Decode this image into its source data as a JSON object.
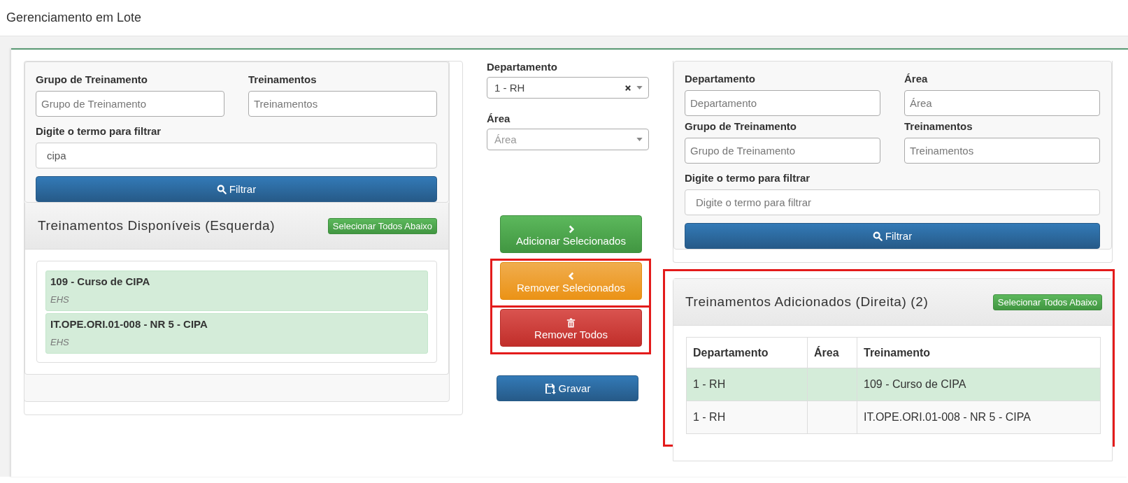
{
  "page_title": "Gerenciamento em Lote",
  "left": {
    "fields": [
      {
        "label": "Grupo de Treinamento",
        "placeholder": "Grupo de Treinamento"
      },
      {
        "label": "Treinamentos",
        "placeholder": "Treinamentos"
      }
    ],
    "term": {
      "label": "Digite o termo para filtrar",
      "value": "cipa"
    },
    "filter_button": "Filtrar",
    "list_panel": {
      "title": "Treinamentos Disponíveis (Esquerda)",
      "select_all": "Selecionar Todos Abaixo",
      "items": [
        {
          "title": "109 - Curso de CIPA",
          "subtitle": "EHS",
          "selected": true
        },
        {
          "title": "IT.OPE.ORI.01-008 - NR 5 - CIPA",
          "subtitle": "EHS",
          "selected": true
        }
      ]
    }
  },
  "middle": {
    "department": {
      "label": "Departamento",
      "value": "1 - RH"
    },
    "area": {
      "label": "Área",
      "placeholder": "Área"
    },
    "actions": [
      {
        "kind": "add",
        "label": "Adicionar Selecionados",
        "highlighted": false
      },
      {
        "kind": "remove",
        "label": "Remover Selecionados",
        "highlighted": true
      },
      {
        "kind": "remove_all",
        "label": "Remover Todos",
        "highlighted": true
      }
    ],
    "save_button": "Gravar"
  },
  "right": {
    "fields": [
      {
        "label": "Departamento",
        "placeholder": "Departamento"
      },
      {
        "label": "Área",
        "placeholder": "Área"
      },
      {
        "label": "Grupo de Treinamento",
        "placeholder": "Grupo de Treinamento"
      },
      {
        "label": "Treinamentos",
        "placeholder": "Treinamentos"
      }
    ],
    "term": {
      "label": "Digite o termo para filtrar",
      "placeholder": "Digite o termo para filtrar"
    },
    "filter_button": "Filtrar",
    "added_panel": {
      "title": "Treinamentos Adicionados (Direita) (2)",
      "select_all": "Selecionar Todos Abaixo",
      "highlighted": true,
      "table": {
        "columns": [
          "Departamento",
          "Área",
          "Treinamento"
        ],
        "rows": [
          {
            "cells": [
              "1 - RH",
              "",
              "109 - Curso de CIPA"
            ],
            "selected": true
          },
          {
            "cells": [
              "1 - RH",
              "",
              "IT.OPE.ORI.01-008 - NR 5 - CIPA"
            ],
            "selected": false
          }
        ]
      }
    }
  }
}
